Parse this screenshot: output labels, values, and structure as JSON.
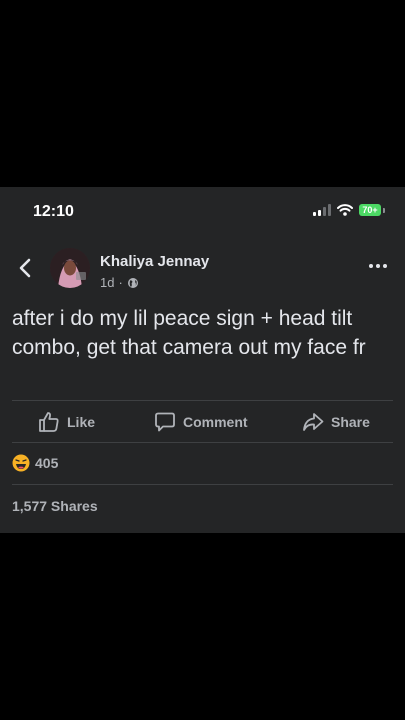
{
  "status_bar": {
    "time": "12:10",
    "battery": "70+"
  },
  "post": {
    "author": "Khaliya Jennay",
    "age": "1d",
    "separator": "·",
    "audience_icon": "globe-icon",
    "text": "after i do my lil peace sign + head tilt combo, get that camera out my face fr"
  },
  "actions": {
    "like": "Like",
    "comment": "Comment",
    "share": "Share"
  },
  "stats": {
    "reaction_icon": "haha-emoji-icon",
    "reaction_count": "405",
    "shares": "1,577 Shares"
  },
  "colors": {
    "background": "#242526",
    "text": "#e4e6eb",
    "muted": "#b0b3b8",
    "battery": "#4cd964"
  }
}
